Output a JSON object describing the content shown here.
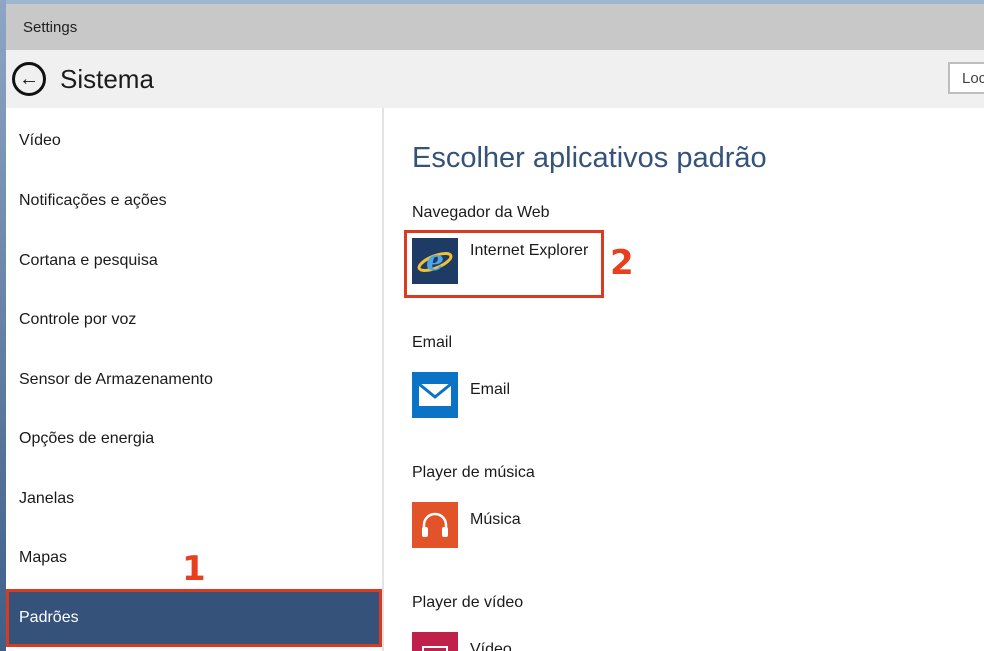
{
  "window": {
    "title": "Settings"
  },
  "header": {
    "title": "Sistema",
    "search_text": "Loca"
  },
  "sidebar": {
    "items": [
      {
        "label": "Vídeo"
      },
      {
        "label": "Notificações e ações"
      },
      {
        "label": "Cortana e pesquisa"
      },
      {
        "label": "Controle por voz"
      },
      {
        "label": "Sensor de Armazenamento"
      },
      {
        "label": "Opções de energia"
      },
      {
        "label": "Janelas"
      },
      {
        "label": "Mapas"
      },
      {
        "label": "Padrões",
        "selected": true
      }
    ]
  },
  "content": {
    "heading": "Escolher aplicativos padrão",
    "groups": [
      {
        "label": "Navegador da Web",
        "app": "Internet Explorer",
        "icon": "internet-explorer-icon",
        "color": "#1e3b66"
      },
      {
        "label": "Email",
        "app": "Email",
        "icon": "mail-icon",
        "color": "#0a73c6"
      },
      {
        "label": "Player de música",
        "app": "Música",
        "icon": "headphones-icon",
        "color": "#e2532a"
      },
      {
        "label": "Player de vídeo",
        "app": "Vídeo",
        "icon": "video-icon",
        "color": "#c0214b"
      }
    ]
  },
  "annotations": {
    "one": "1",
    "two": "2"
  },
  "colors": {
    "accent": "#34527a",
    "annotation": "#e8401e"
  }
}
